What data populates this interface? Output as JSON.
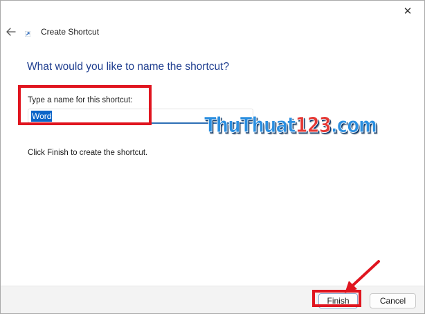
{
  "window": {
    "close_glyph": "✕",
    "title": "Create Shortcut"
  },
  "main": {
    "heading": "What would you like to name the shortcut?",
    "field_label": "Type a name for this shortcut:",
    "field_value": "Word",
    "hint": "Click Finish to create the shortcut."
  },
  "watermark": {
    "part1": "ThuThuat",
    "part2": "123",
    "part3": ".com"
  },
  "footer": {
    "finish_label": "Finish",
    "cancel_label": "Cancel"
  },
  "colors": {
    "heading": "#1e3d8f",
    "selection": "#0a64c8",
    "annotation_red": "#e0151f"
  },
  "icons": [
    "close-icon",
    "back-arrow-icon",
    "shortcut-icon"
  ]
}
